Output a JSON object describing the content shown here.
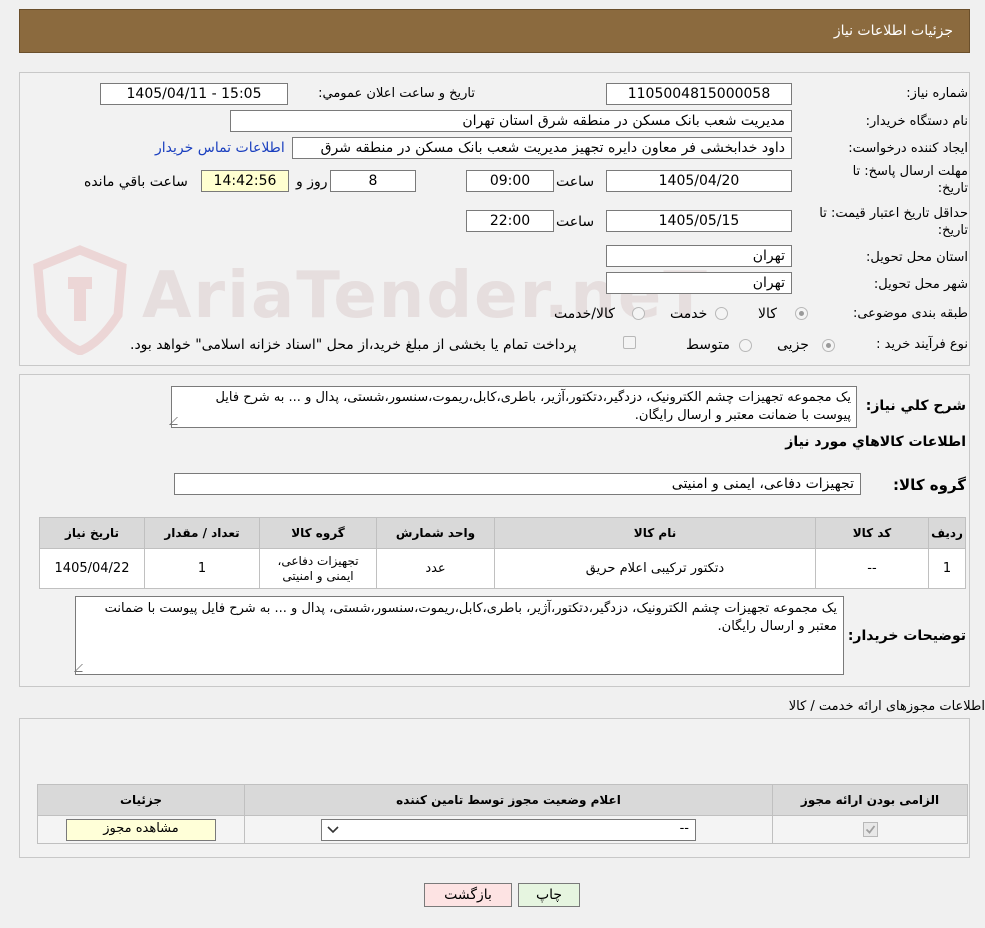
{
  "header": {
    "title": "جزئیات اطلاعات نیاز"
  },
  "watermark": {
    "text": "AriaTender.neT"
  },
  "form": {
    "need_number_label": "شماره نیاز:",
    "need_number": "1105004815000058",
    "announce_label": "تاريخ و ساعت اعلان عمومي:",
    "announce_value": "1405/04/11 - 15:05",
    "buyer_org_label": "نام دستگاه خريدار:",
    "buyer_org": "مدیریت شعب بانک مسکن در منطقه شرق استان تهران",
    "creator_label": "ايجاد کننده درخواست:",
    "creator": "داود خدابخشی فر معاون دایره تجهیز مدیریت شعب بانک مسکن در منطقه شرق",
    "contact_link": "اطلاعات تماس خریدار",
    "deadline_label_1": "مهلت ارسال پاسخ: تا",
    "deadline_label_2": "تاریخ:",
    "deadline_date": "1405/04/20",
    "time_label": "ساعت",
    "deadline_time": "09:00",
    "days": "8",
    "days_label": "روز و",
    "remaining": "14:42:56",
    "remaining_label": "ساعت باقي مانده",
    "validity_label_1": "حداقل تاريخ اعتبار قيمت: تا",
    "validity_label_2": "تاریخ:",
    "validity_date": "1405/05/15",
    "validity_time": "22:00",
    "province_label": "استان محل تحویل:",
    "province": "تهران",
    "city_label": "شهر محل تحویل:",
    "city": "تهران",
    "category_label": "طبقه بندی موضوعی:",
    "category_options": [
      "کالا",
      "خدمت",
      "کالا/خدمت"
    ],
    "process_label": "نوع فرآیند خرید :",
    "process_options": [
      "جزیی",
      "متوسط"
    ],
    "payment_note": "پرداخت تمام یا بخشی از مبلغ خرید،از محل \"اسناد خزانه اسلامی\" خواهد بود."
  },
  "description": {
    "label": "شرح کلي نياز:",
    "text": "یک مجموعه تجهیزات چشم الکترونیک، دزدگیر،دتکتور،آژیر، باطری،کابل،ریموت،سنسور،شستی، پدال و ... به شرح فایل پیوست با ضمانت معتبر و ارسال رایگان."
  },
  "goods": {
    "section_title": "اطلاعات کالاهاي مورد نياز",
    "group_label": "گروه کالا:",
    "group_value": "تجهیزات دفاعی، ایمنی و امنیتی",
    "columns": [
      "رديف",
      "کد کالا",
      "نام کالا",
      "واحد شمارش",
      "گروه کالا",
      "تعداد / مقدار",
      "تاریخ نیاز"
    ],
    "rows": [
      {
        "row": "1",
        "code": "--",
        "name": "دتکتور ترکیبی اعلام حریق",
        "unit": "عدد",
        "group": "تجهیزات دفاعی، ایمنی و امنیتی",
        "qty": "1",
        "date": "1405/04/22"
      }
    ]
  },
  "buyer_notes": {
    "label": "توضیحات خریدار:",
    "text": "یک مجموعه تجهیزات چشم الکترونیک، دزدگیر،دتکتور،آژیر، باطری،کابل،ریموت،سنسور،شستی، پدال و ... به شرح فایل پیوست با ضمانت معتبر و ارسال رایگان."
  },
  "licenses": {
    "section_title": "اطلاعات مجوزهای ارائه خدمت / کالا",
    "columns": [
      "الزامی بودن ارائه مجوز",
      "اعلام وضعیت مجوز توسط تامین کننده",
      "جزئیات"
    ],
    "select_value": "--",
    "view_button": "مشاهده مجوز"
  },
  "buttons": {
    "print": "چاپ",
    "back": "بازگشت"
  },
  "colors": {
    "header": "#8b6a3e",
    "print_btn": "#e6f5e0",
    "back_btn": "#fde3e3",
    "link": "#1a3fbf"
  }
}
